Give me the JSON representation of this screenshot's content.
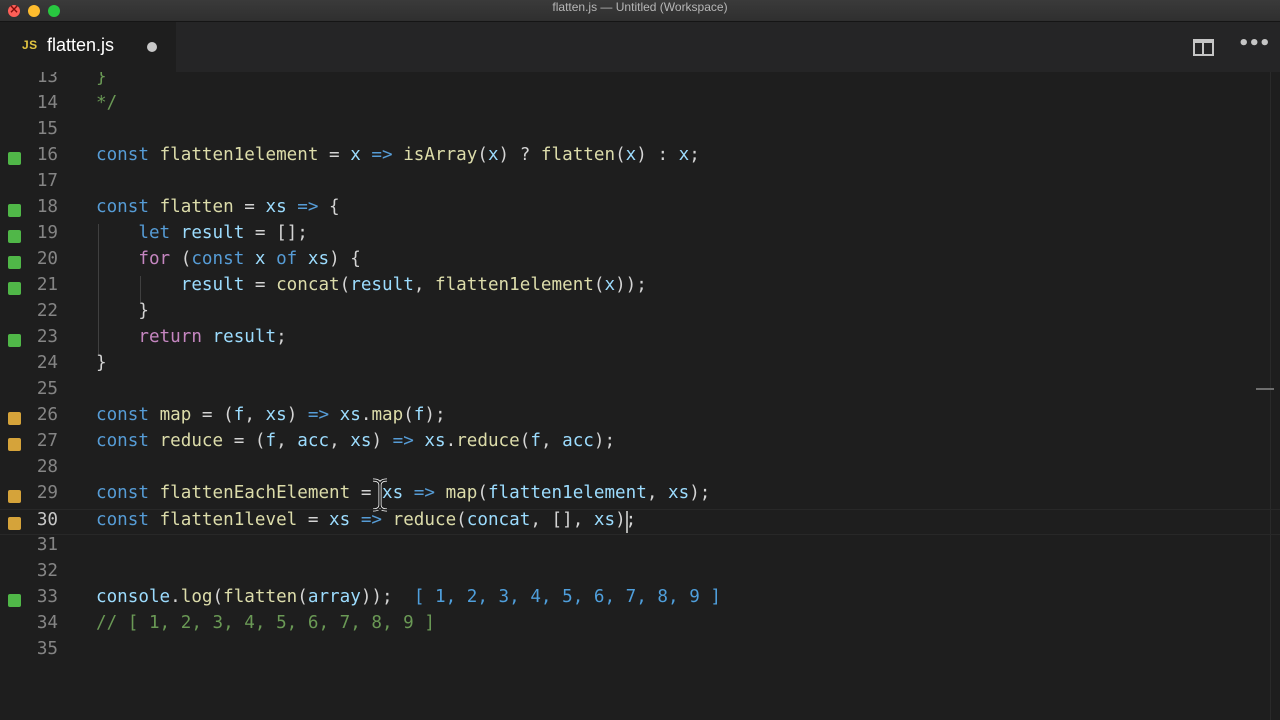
{
  "window": {
    "title": "flatten.js — Untitled (Workspace)"
  },
  "tab": {
    "lang_badge": "JS",
    "filename": "flatten.js",
    "dirty": true
  },
  "editor_actions": {
    "split_icon": "split-editor-icon",
    "more_icon": "more-actions-icon",
    "more_glyph": "•••"
  },
  "colors": {
    "keyword": "#569cd6",
    "control": "#c586c0",
    "function": "#dcdcaa",
    "variable": "#9cdcfe",
    "comment": "#6a9955",
    "gutter_added": "#50b748",
    "gutter_modified": "#d5a33a"
  },
  "cursor": {
    "line": 30
  },
  "lines": [
    {
      "n": "13",
      "git": "",
      "tokens": [
        {
          "t": "}",
          "c": "cm"
        }
      ]
    },
    {
      "n": "14",
      "git": "",
      "tokens": [
        {
          "t": "*/",
          "c": "cm"
        }
      ]
    },
    {
      "n": "15",
      "git": "",
      "tokens": []
    },
    {
      "n": "16",
      "git": "added",
      "tokens": [
        {
          "t": "const",
          "c": "kw"
        },
        {
          "t": " ",
          "c": "p"
        },
        {
          "t": "flatten1element",
          "c": "fn"
        },
        {
          "t": " = ",
          "c": "p"
        },
        {
          "t": "x",
          "c": "var"
        },
        {
          "t": " ",
          "c": "p"
        },
        {
          "t": "=>",
          "c": "kw"
        },
        {
          "t": " ",
          "c": "p"
        },
        {
          "t": "isArray",
          "c": "fn"
        },
        {
          "t": "(",
          "c": "p"
        },
        {
          "t": "x",
          "c": "var"
        },
        {
          "t": ") ? ",
          "c": "p"
        },
        {
          "t": "flatten",
          "c": "fn"
        },
        {
          "t": "(",
          "c": "p"
        },
        {
          "t": "x",
          "c": "var"
        },
        {
          "t": ") : ",
          "c": "p"
        },
        {
          "t": "x",
          "c": "var"
        },
        {
          "t": ";",
          "c": "p"
        }
      ]
    },
    {
      "n": "17",
      "git": "",
      "tokens": []
    },
    {
      "n": "18",
      "git": "added",
      "tokens": [
        {
          "t": "const",
          "c": "kw"
        },
        {
          "t": " ",
          "c": "p"
        },
        {
          "t": "flatten",
          "c": "fn"
        },
        {
          "t": " = ",
          "c": "p"
        },
        {
          "t": "xs",
          "c": "var"
        },
        {
          "t": " ",
          "c": "p"
        },
        {
          "t": "=>",
          "c": "kw"
        },
        {
          "t": " {",
          "c": "p"
        }
      ]
    },
    {
      "n": "19",
      "git": "added",
      "tokens": [
        {
          "t": "    ",
          "c": "p"
        },
        {
          "t": "let",
          "c": "kw"
        },
        {
          "t": " ",
          "c": "p"
        },
        {
          "t": "result",
          "c": "var"
        },
        {
          "t": " = [];",
          "c": "p"
        }
      ]
    },
    {
      "n": "20",
      "git": "added",
      "tokens": [
        {
          "t": "    ",
          "c": "p"
        },
        {
          "t": "for",
          "c": "ctrl"
        },
        {
          "t": " (",
          "c": "p"
        },
        {
          "t": "const",
          "c": "kw"
        },
        {
          "t": " ",
          "c": "p"
        },
        {
          "t": "x",
          "c": "var"
        },
        {
          "t": " ",
          "c": "p"
        },
        {
          "t": "of",
          "c": "kw"
        },
        {
          "t": " ",
          "c": "p"
        },
        {
          "t": "xs",
          "c": "var"
        },
        {
          "t": ") {",
          "c": "p"
        }
      ]
    },
    {
      "n": "21",
      "git": "added",
      "tokens": [
        {
          "t": "        ",
          "c": "p"
        },
        {
          "t": "result",
          "c": "var"
        },
        {
          "t": " = ",
          "c": "p"
        },
        {
          "t": "concat",
          "c": "fn"
        },
        {
          "t": "(",
          "c": "p"
        },
        {
          "t": "result",
          "c": "var"
        },
        {
          "t": ", ",
          "c": "p"
        },
        {
          "t": "flatten1element",
          "c": "fn"
        },
        {
          "t": "(",
          "c": "p"
        },
        {
          "t": "x",
          "c": "var"
        },
        {
          "t": "));",
          "c": "p"
        }
      ]
    },
    {
      "n": "22",
      "git": "",
      "tokens": [
        {
          "t": "    }",
          "c": "p"
        }
      ]
    },
    {
      "n": "23",
      "git": "added",
      "tokens": [
        {
          "t": "    ",
          "c": "p"
        },
        {
          "t": "return",
          "c": "ctrl"
        },
        {
          "t": " ",
          "c": "p"
        },
        {
          "t": "result",
          "c": "var"
        },
        {
          "t": ";",
          "c": "p"
        }
      ]
    },
    {
      "n": "24",
      "git": "",
      "tokens": [
        {
          "t": "}",
          "c": "p"
        }
      ]
    },
    {
      "n": "25",
      "git": "",
      "tokens": []
    },
    {
      "n": "26",
      "git": "modified",
      "tokens": [
        {
          "t": "const",
          "c": "kw"
        },
        {
          "t": " ",
          "c": "p"
        },
        {
          "t": "map",
          "c": "fn"
        },
        {
          "t": " = (",
          "c": "p"
        },
        {
          "t": "f",
          "c": "var"
        },
        {
          "t": ", ",
          "c": "p"
        },
        {
          "t": "xs",
          "c": "var"
        },
        {
          "t": ") ",
          "c": "p"
        },
        {
          "t": "=>",
          "c": "kw"
        },
        {
          "t": " ",
          "c": "p"
        },
        {
          "t": "xs",
          "c": "var"
        },
        {
          "t": ".",
          "c": "p"
        },
        {
          "t": "map",
          "c": "fn"
        },
        {
          "t": "(",
          "c": "p"
        },
        {
          "t": "f",
          "c": "var"
        },
        {
          "t": ");",
          "c": "p"
        }
      ]
    },
    {
      "n": "27",
      "git": "modified",
      "tokens": [
        {
          "t": "const",
          "c": "kw"
        },
        {
          "t": " ",
          "c": "p"
        },
        {
          "t": "reduce",
          "c": "fn"
        },
        {
          "t": " = (",
          "c": "p"
        },
        {
          "t": "f",
          "c": "var"
        },
        {
          "t": ", ",
          "c": "p"
        },
        {
          "t": "acc",
          "c": "var"
        },
        {
          "t": ", ",
          "c": "p"
        },
        {
          "t": "xs",
          "c": "var"
        },
        {
          "t": ") ",
          "c": "p"
        },
        {
          "t": "=>",
          "c": "kw"
        },
        {
          "t": " ",
          "c": "p"
        },
        {
          "t": "xs",
          "c": "var"
        },
        {
          "t": ".",
          "c": "p"
        },
        {
          "t": "reduce",
          "c": "fn"
        },
        {
          "t": "(",
          "c": "p"
        },
        {
          "t": "f",
          "c": "var"
        },
        {
          "t": ", ",
          "c": "p"
        },
        {
          "t": "acc",
          "c": "var"
        },
        {
          "t": ");",
          "c": "p"
        }
      ]
    },
    {
      "n": "28",
      "git": "",
      "tokens": []
    },
    {
      "n": "29",
      "git": "modified",
      "tokens": [
        {
          "t": "const",
          "c": "kw"
        },
        {
          "t": " ",
          "c": "p"
        },
        {
          "t": "flattenEachElement",
          "c": "fn"
        },
        {
          "t": " = ",
          "c": "p"
        },
        {
          "t": "xs",
          "c": "var"
        },
        {
          "t": " ",
          "c": "p"
        },
        {
          "t": "=>",
          "c": "kw"
        },
        {
          "t": " ",
          "c": "p"
        },
        {
          "t": "map",
          "c": "fn"
        },
        {
          "t": "(",
          "c": "p"
        },
        {
          "t": "flatten1element",
          "c": "var"
        },
        {
          "t": ", ",
          "c": "p"
        },
        {
          "t": "xs",
          "c": "var"
        },
        {
          "t": ");",
          "c": "p"
        }
      ]
    },
    {
      "n": "30",
      "git": "modified",
      "tokens": [
        {
          "t": "const",
          "c": "kw"
        },
        {
          "t": " ",
          "c": "p"
        },
        {
          "t": "flatten1level",
          "c": "fn"
        },
        {
          "t": " = ",
          "c": "p"
        },
        {
          "t": "xs",
          "c": "var"
        },
        {
          "t": " ",
          "c": "p"
        },
        {
          "t": "=>",
          "c": "kw"
        },
        {
          "t": " ",
          "c": "p"
        },
        {
          "t": "reduce",
          "c": "fn"
        },
        {
          "t": "(",
          "c": "p"
        },
        {
          "t": "concat",
          "c": "var"
        },
        {
          "t": ", [], ",
          "c": "p"
        },
        {
          "t": "xs",
          "c": "var"
        },
        {
          "t": ");",
          "c": "p"
        }
      ]
    },
    {
      "n": "31",
      "git": "",
      "tokens": []
    },
    {
      "n": "32",
      "git": "",
      "tokens": []
    },
    {
      "n": "33",
      "git": "added",
      "tokens": [
        {
          "t": "console",
          "c": "var"
        },
        {
          "t": ".",
          "c": "p"
        },
        {
          "t": "log",
          "c": "fn"
        },
        {
          "t": "(",
          "c": "p"
        },
        {
          "t": "flatten",
          "c": "fn"
        },
        {
          "t": "(",
          "c": "p"
        },
        {
          "t": "array",
          "c": "var"
        },
        {
          "t": "));  ",
          "c": "p"
        },
        {
          "t": "[ 1, 2, 3, 4, 5, 6, 7, 8, 9 ]",
          "c": "inline"
        }
      ]
    },
    {
      "n": "34",
      "git": "",
      "tokens": [
        {
          "t": "// [ 1, 2, 3, 4, 5, 6, 7, 8, 9 ]",
          "c": "cm"
        }
      ]
    },
    {
      "n": "35",
      "git": "",
      "tokens": []
    }
  ]
}
